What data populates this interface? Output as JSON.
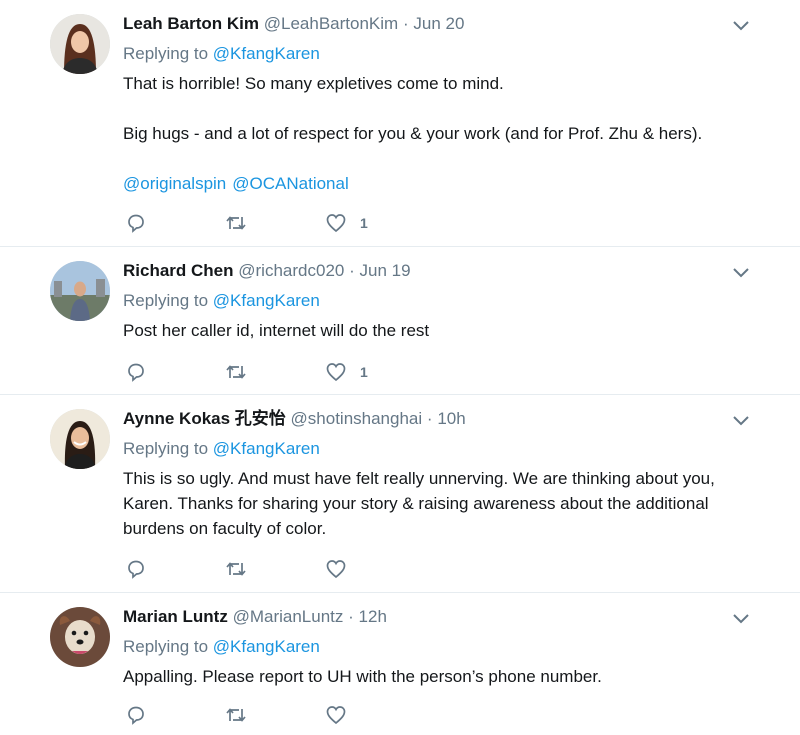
{
  "colors": {
    "link": "#1b95e0",
    "secondary": "#657786",
    "text": "#14171a",
    "divider": "#e6ecf0"
  },
  "tweets": [
    {
      "name": "Leah Barton Kim",
      "handle": "@LeahBartonKim",
      "separator": "·",
      "time": "Jun 20",
      "replying_prefix": "Replying to",
      "replying_to": "@KfangKaren",
      "text_lines": [
        "That is horrible! So many expletives come to mind.",
        "Big hugs - and a lot of respect for you & your work (and for Prof. Zhu & hers)."
      ],
      "mentions": [
        "@originalspin",
        "@OCANational"
      ],
      "like_count": "1",
      "avatar": "woman-long-hair"
    },
    {
      "name": "Richard Chen",
      "handle": "@richardc020",
      "separator": "·",
      "time": "Jun 19",
      "replying_prefix": "Replying to",
      "replying_to": "@KfangKaren",
      "text": "Post her caller id, internet will do the rest",
      "like_count": "1",
      "avatar": "man-outdoor"
    },
    {
      "name": "Aynne Kokas 孔安怡",
      "handle": "@shotinshanghai",
      "separator": "·",
      "time": "10h",
      "replying_prefix": "Replying to",
      "replying_to": "@KfangKaren",
      "text": "This is so ugly. And must have felt really unnerving. We are thinking about you, Karen. Thanks for sharing your story & raising awareness about the additional burdens on faculty of color.",
      "like_count": "",
      "avatar": "woman-smiling"
    },
    {
      "name": "Marian Luntz",
      "handle": "@MarianLuntz",
      "separator": "·",
      "time": "12h",
      "replying_prefix": "Replying to",
      "replying_to": "@KfangKaren",
      "text": "Appalling. Please report to UH with the person’s phone number.",
      "like_count": "",
      "avatar": "dog"
    }
  ],
  "icons": {
    "reply": "reply-icon",
    "retweet": "retweet-icon",
    "like": "heart-icon",
    "more": "chevron-down-icon"
  }
}
